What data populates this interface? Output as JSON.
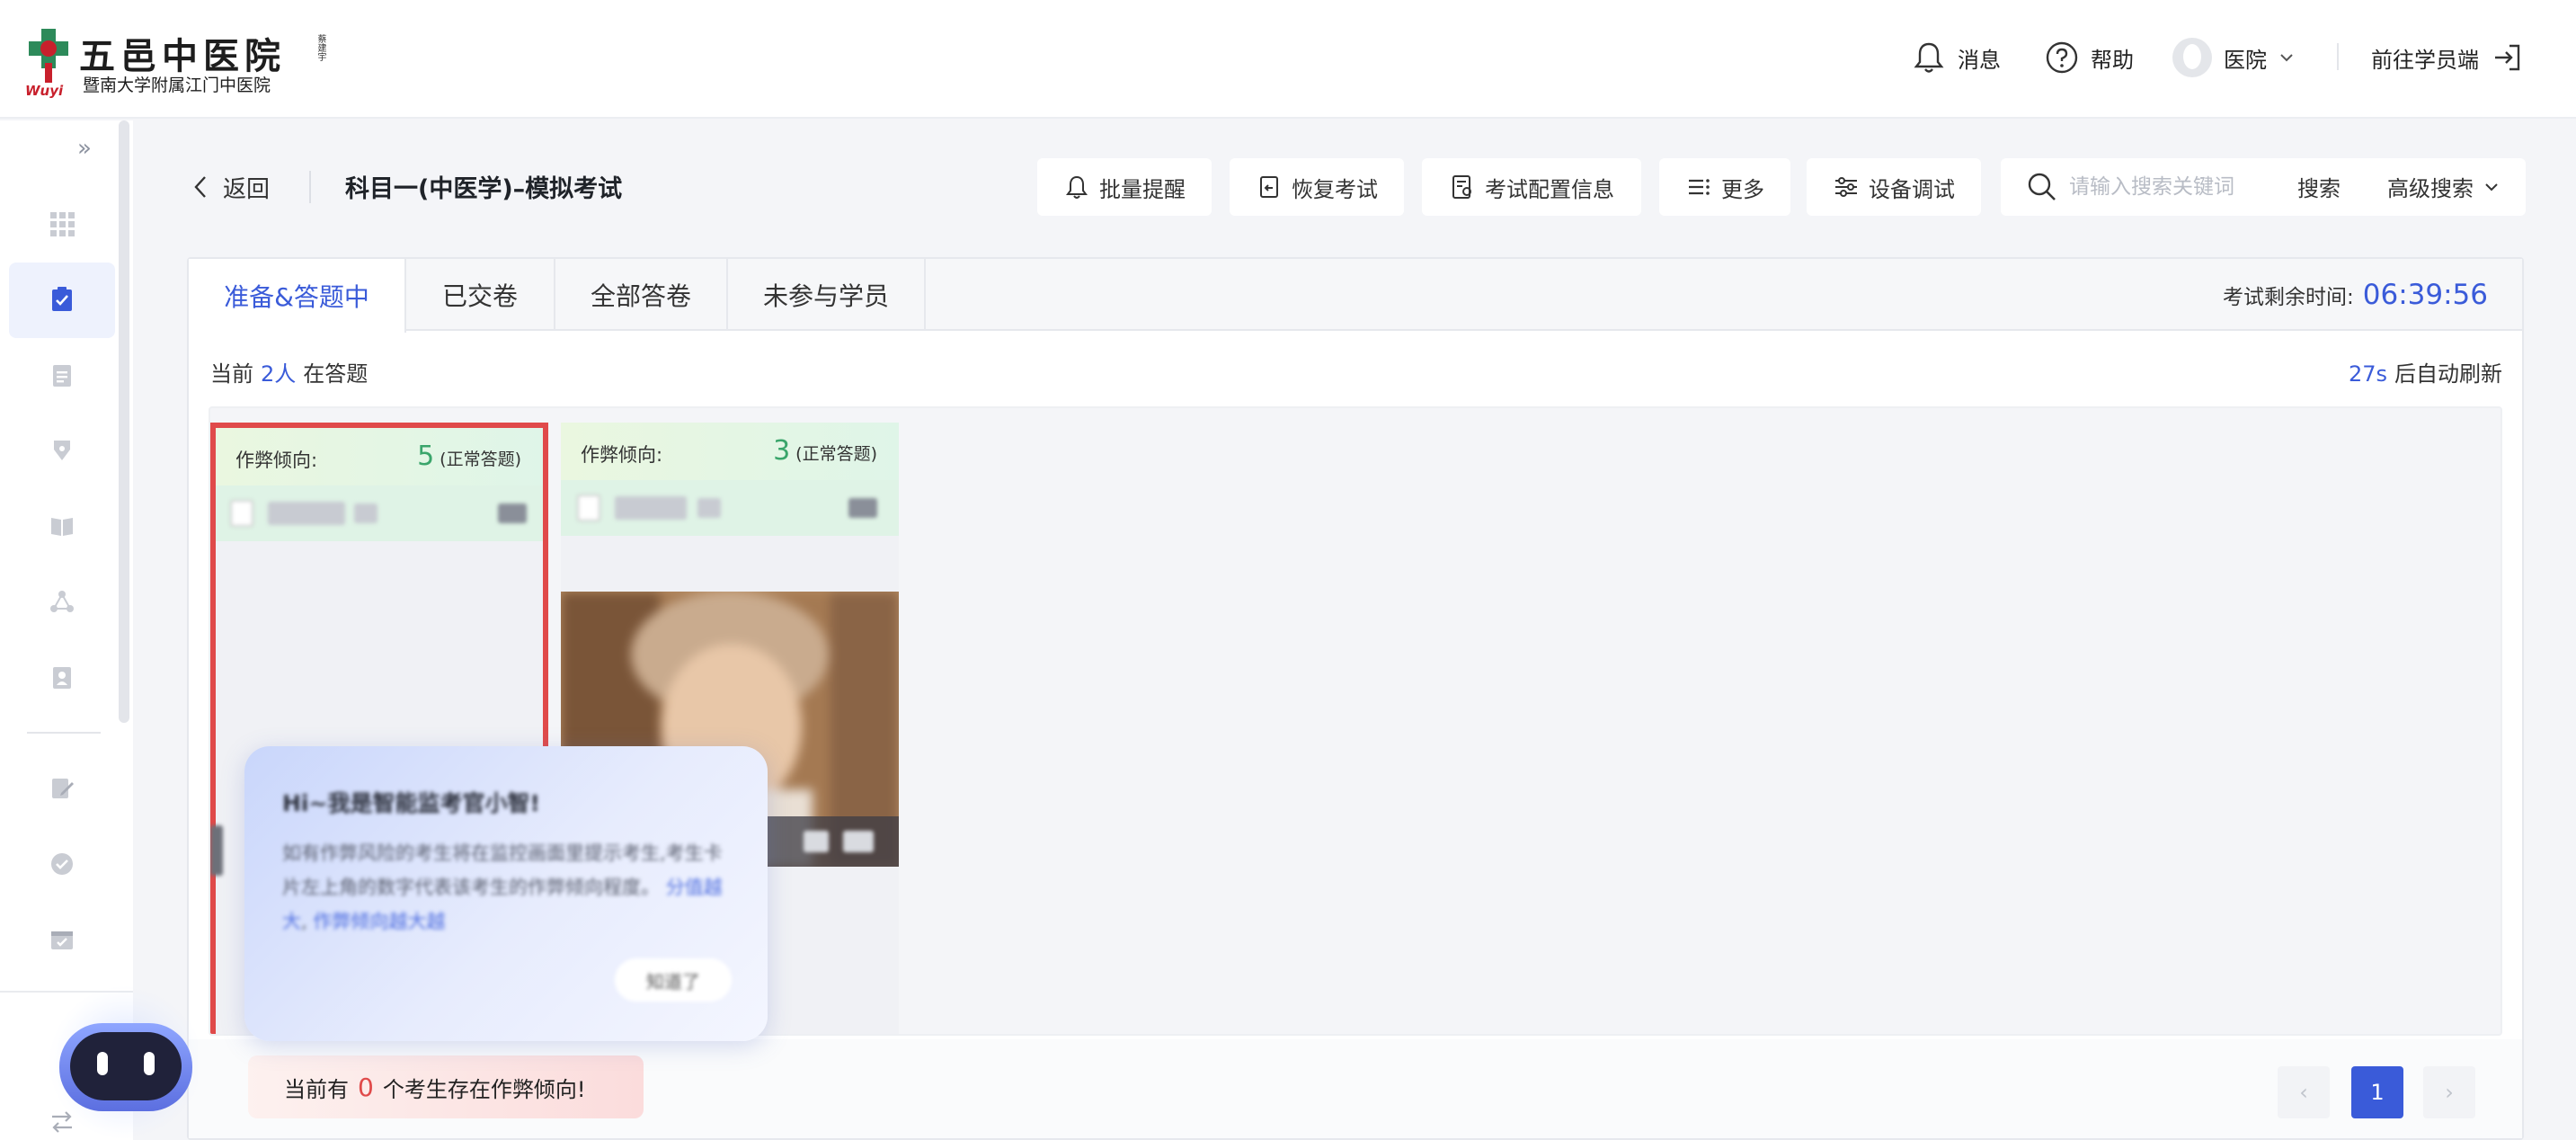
{
  "header": {
    "logo": {
      "title": "五邑中医院",
      "subtitle": "暨南大学附属江门中医院",
      "mark_text": "Wuyi",
      "seal_text": "蔡建宇"
    },
    "messages_label": "消息",
    "help_label": "帮助",
    "user_label": "医院",
    "go_student_label": "前往学员端"
  },
  "toolbar": {
    "back_label": "返回",
    "exam_title": "科目一(中医学)–模拟考试",
    "buttons": [
      {
        "label": "批量提醒",
        "icon": "bell-icon"
      },
      {
        "label": "恢复考试",
        "icon": "restore-icon"
      },
      {
        "label": "考试配置信息",
        "icon": "config-doc-icon"
      },
      {
        "label": "更多",
        "icon": "list-icon"
      },
      {
        "label": "设备调试",
        "icon": "sliders-icon"
      }
    ],
    "search": {
      "placeholder": "请输入搜索关键词",
      "search_label": "搜索",
      "advanced_label": "高级搜索"
    }
  },
  "tabs": [
    {
      "label": "准备&答题中",
      "active": true
    },
    {
      "label": "已交卷",
      "active": false
    },
    {
      "label": "全部答卷",
      "active": false
    },
    {
      "label": "未参与学员",
      "active": false
    }
  ],
  "remaining": {
    "label": "考试剩余时间:",
    "time": "06:39:56"
  },
  "status": {
    "prefix": "当前",
    "count": "2人",
    "suffix": "在答题",
    "refresh_seconds": "27s",
    "refresh_suffix": "后自动刷新"
  },
  "cards": [
    {
      "cheat_label": "作弊倾向:",
      "score": "5",
      "score_note": "(正常答题)",
      "selected": true,
      "has_video": false
    },
    {
      "cheat_label": "作弊倾向:",
      "score": "3",
      "score_note": "(正常答题)",
      "selected": false,
      "has_video": true
    }
  ],
  "tip": {
    "title": "Hi~我是智能监考官小智!",
    "text": "如有作弊风险的考生将在监控画面里提示考生,考生卡片左上角的数字代表该考生的作弊倾向程度。",
    "link1": "分值越大",
    "link2": "作弊倾向越大越",
    "button": "知道了"
  },
  "bottom": {
    "note_prefix": "当前有",
    "note_count": "0",
    "note_suffix": "个考生存在作弊倾向!",
    "page_current": "1",
    "prev": "‹",
    "next": "›"
  },
  "colors": {
    "accent": "#3a5bd9",
    "danger": "#e04a4a",
    "score_green": "#3aa56b"
  }
}
